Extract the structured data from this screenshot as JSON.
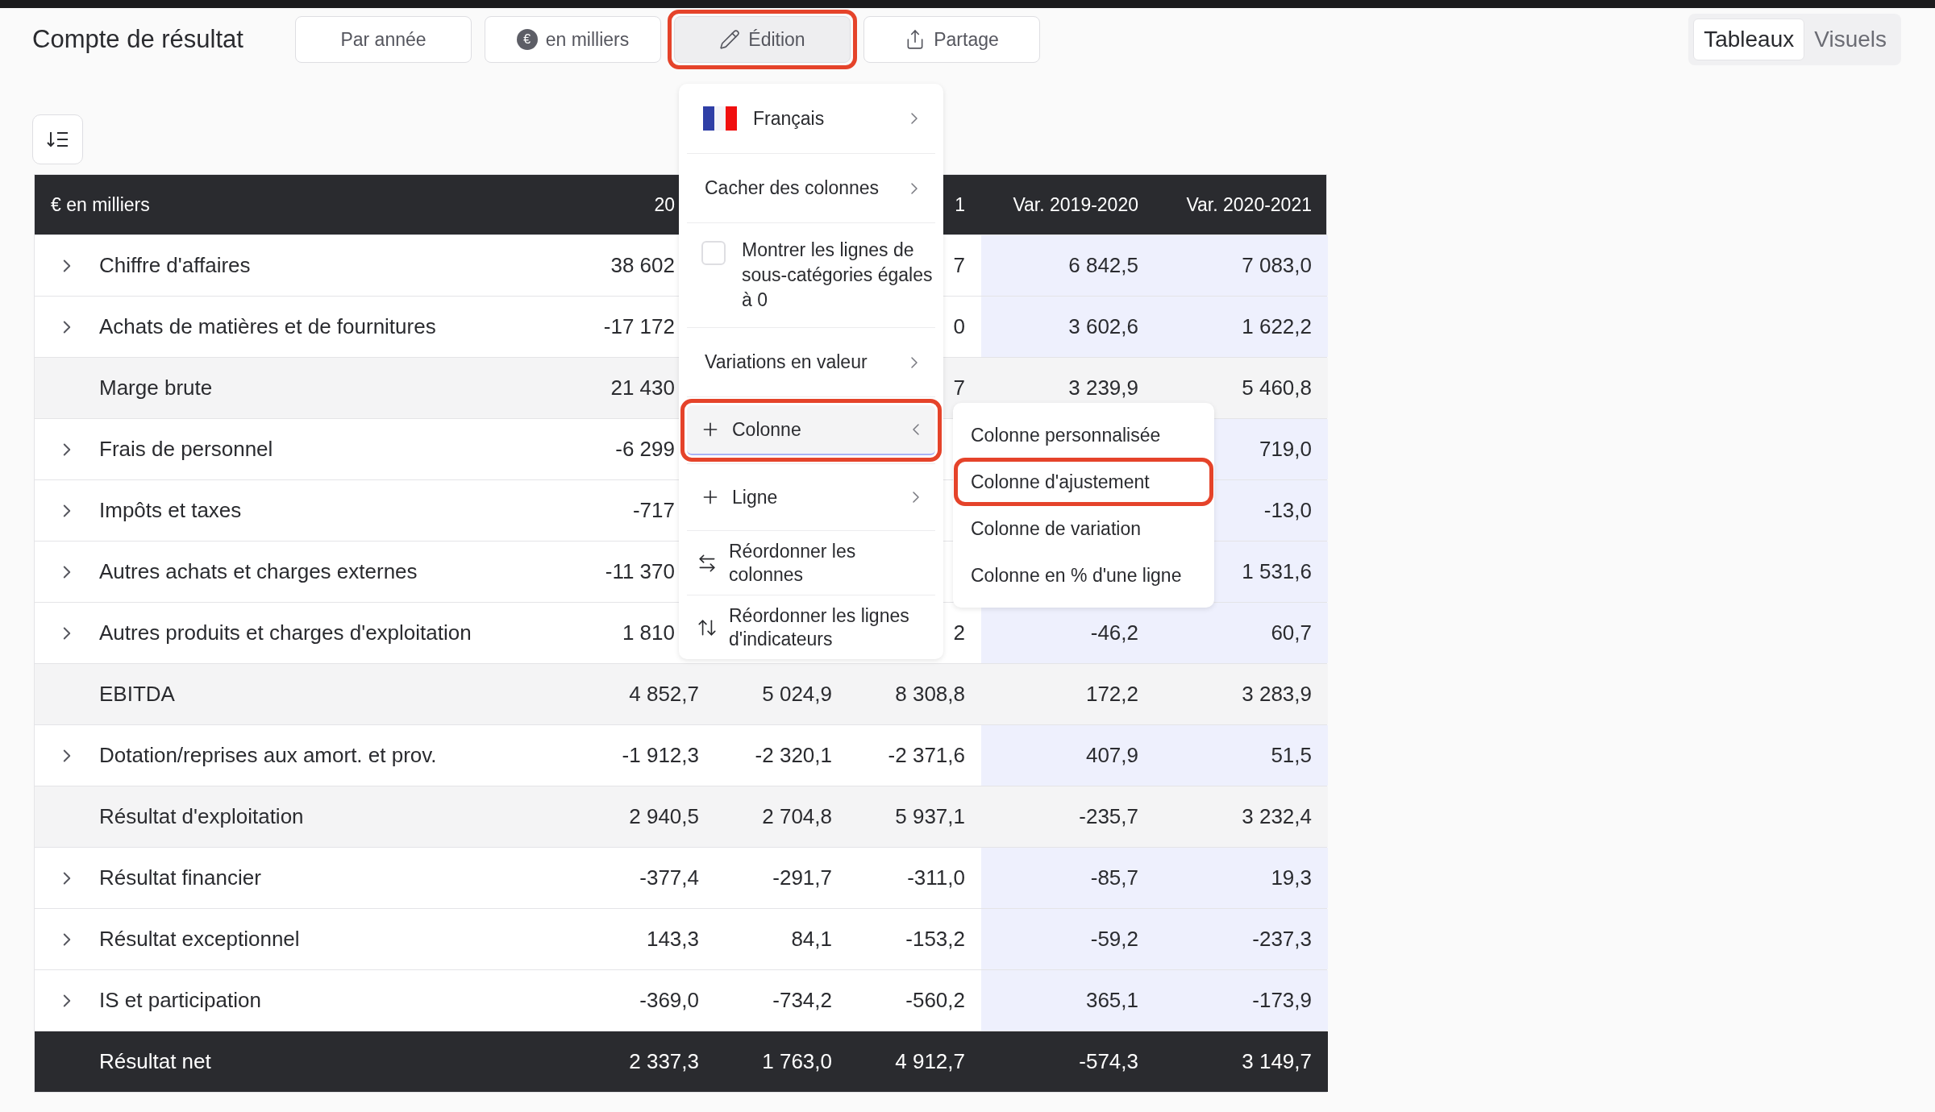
{
  "toolbar": {
    "title": "Compte de résultat",
    "buttons": [
      {
        "kind": "plain",
        "label": "Par année",
        "pressed": false,
        "highlighted": false
      },
      {
        "kind": "currency",
        "icon_text": "€",
        "label": "en milliers",
        "pressed": false,
        "highlighted": false
      },
      {
        "kind": "edit",
        "label": "Édition",
        "pressed": true,
        "highlighted": true
      },
      {
        "kind": "share",
        "label": "Partage",
        "pressed": false,
        "highlighted": false
      }
    ],
    "view_tabs": [
      {
        "label": "Tableaux",
        "selected": true
      },
      {
        "label": "Visuels",
        "selected": false
      }
    ]
  },
  "table": {
    "columns": [
      {
        "kind": "label",
        "heading": "€ en milliers"
      },
      {
        "kind": "year",
        "heading": "20"
      },
      {
        "kind": "year"
      },
      {
        "kind": "year",
        "heading": "1"
      },
      {
        "kind": "variation",
        "heading": "Var. 2019-2020"
      },
      {
        "kind": "variation",
        "heading": "Var. 2020-2021"
      }
    ],
    "rows": [
      {
        "kind": "detail",
        "label": "Chiffre d'affaires",
        "first_year": "38 602",
        "third_year": "7",
        "first_variation": "6 842,5",
        "second_variation": "7 083,0"
      },
      {
        "kind": "detail",
        "label": "Achats de matières et de fournitures",
        "first_year": "-17 172",
        "third_year": "0",
        "first_variation": "3 602,6",
        "second_variation": "1 622,2"
      },
      {
        "kind": "subtotal",
        "label": "Marge brute",
        "first_year": "21 430",
        "third_year": "7",
        "first_variation": "3 239,9",
        "second_variation": "5 460,8"
      },
      {
        "kind": "detail",
        "label": "Frais de personnel",
        "first_year": "-6 299",
        "second_variation": "719,0"
      },
      {
        "kind": "detail",
        "label": "Impôts et taxes",
        "first_year": "-717",
        "second_variation": "-13,0"
      },
      {
        "kind": "detail",
        "label": "Autres achats et charges externes",
        "first_year": "-11 370",
        "second_variation": "1 531,6"
      },
      {
        "kind": "detail",
        "label": "Autres produits et charges d'exploitation",
        "first_year": "1 810",
        "third_year": "2",
        "first_variation": "-46,2",
        "second_variation": "60,7"
      },
      {
        "kind": "subtotal",
        "label": "EBITDA",
        "first_year": "4 852,7",
        "second_year": "5 024,9",
        "third_year": "8 308,8",
        "first_variation": "172,2",
        "second_variation": "3 283,9"
      },
      {
        "kind": "detail",
        "label": "Dotation/reprises aux amort. et prov.",
        "first_year": "-1 912,3",
        "second_year": "-2 320,1",
        "third_year": "-2 371,6",
        "first_variation": "407,9",
        "second_variation": "51,5"
      },
      {
        "kind": "subtotal",
        "label": "Résultat d'exploitation",
        "first_year": "2 940,5",
        "second_year": "2 704,8",
        "third_year": "5 937,1",
        "first_variation": "-235,7",
        "second_variation": "3 232,4"
      },
      {
        "kind": "detail",
        "label": "Résultat financier",
        "first_year": "-377,4",
        "second_year": "-291,7",
        "third_year": "-311,0",
        "first_variation": "-85,7",
        "second_variation": "19,3"
      },
      {
        "kind": "detail",
        "label": "Résultat exceptionnel",
        "first_year": "143,3",
        "second_year": "84,1",
        "third_year": "-153,2",
        "first_variation": "-59,2",
        "second_variation": "-237,3"
      },
      {
        "kind": "detail",
        "label": "IS et participation",
        "first_year": "-369,0",
        "second_year": "-734,2",
        "third_year": "-560,2",
        "first_variation": "365,1",
        "second_variation": "-173,9"
      },
      {
        "kind": "total",
        "label": "Résultat net",
        "first_year": "2 337,3",
        "second_year": "1 763,0",
        "third_year": "4 912,7",
        "first_variation": "-574,3",
        "second_variation": "3 149,7"
      }
    ]
  },
  "edit_menu": {
    "items": [
      {
        "kind": "language",
        "label": "Français"
      },
      {
        "kind": "submenu",
        "label": "Cacher des colonnes"
      },
      {
        "kind": "checkbox",
        "label": "Montrer les lignes de sous-catégories égales à 0",
        "checked": false
      },
      {
        "kind": "submenu",
        "label": "Variations en valeur"
      },
      {
        "kind": "add",
        "label": "Colonne",
        "expanded": true,
        "highlighted": true
      },
      {
        "kind": "add",
        "label": "Ligne",
        "expanded": false,
        "highlighted": false
      },
      {
        "kind": "reorder_columns",
        "label": "Réordonner les colonnes"
      },
      {
        "kind": "reorder_rows",
        "label": "Réordonner les lignes d'indicateurs"
      }
    ],
    "submenu": [
      {
        "label": "Colonne personnalisée",
        "highlighted": false
      },
      {
        "label": "Colonne d'ajustement",
        "highlighted": true
      },
      {
        "label": "Colonne de variation",
        "highlighted": false
      },
      {
        "label": "Colonne en % d'une ligne",
        "highlighted": false
      }
    ]
  }
}
